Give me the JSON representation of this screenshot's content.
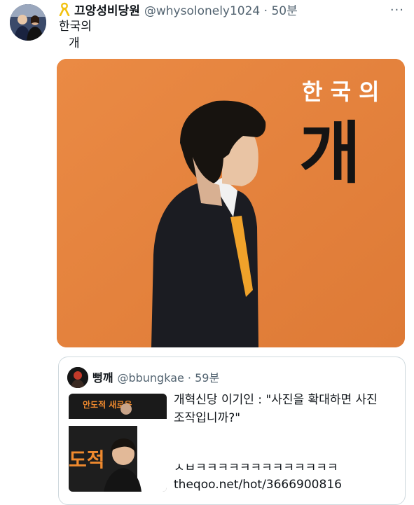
{
  "tweet": {
    "author_name": "끄앙성비당원",
    "handle_time": "@whysolonely1024 · 50분",
    "text_line1": "한국의",
    "text_line2": "개",
    "more_label": "···"
  },
  "media": {
    "banner_small": "한 국 의",
    "banner_big": "개"
  },
  "quote": {
    "author_name": "뻥깨",
    "handle_time": "@bbungkae · 59분",
    "text_line1": "개혁신당 이기인 : \"사진을 확대하면 사진",
    "text_line2": "조작입니까?\"",
    "laugh": "ㅅㅂㅋㅋㅋㅋㅋㅋㅋㅋㅋㅋㅋㅋㅋ",
    "link": "theqoo.net/hot/3666900816",
    "thumb_text_top": "안도적 새로움",
    "thumb_text_mid": "도적"
  },
  "colors": {
    "orange": "#e5813b",
    "ribbon": "#f2c10f",
    "handle_gray": "#536471"
  }
}
